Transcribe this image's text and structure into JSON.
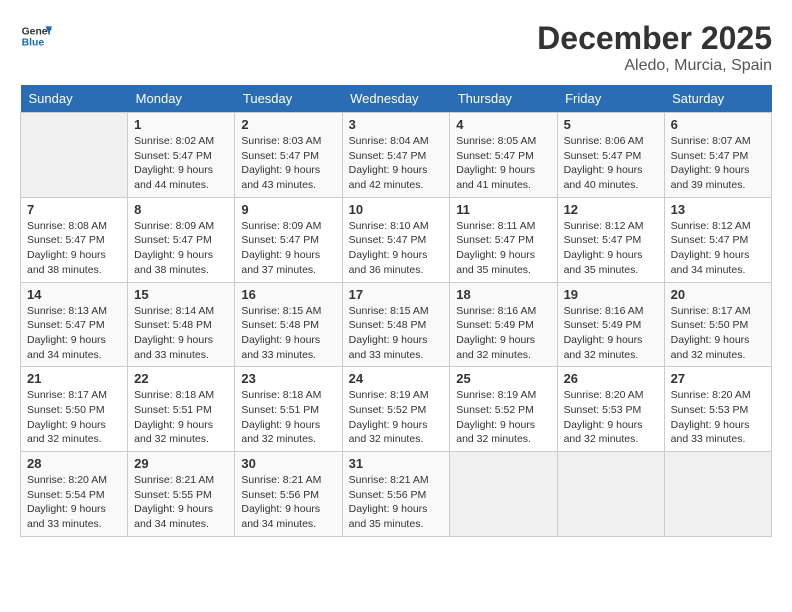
{
  "header": {
    "logo_general": "General",
    "logo_blue": "Blue",
    "month_title": "December 2025",
    "location": "Aledo, Murcia, Spain"
  },
  "days_of_week": [
    "Sunday",
    "Monday",
    "Tuesday",
    "Wednesday",
    "Thursday",
    "Friday",
    "Saturday"
  ],
  "weeks": [
    [
      {
        "day": "",
        "sunrise": "",
        "sunset": "",
        "daylight": ""
      },
      {
        "day": "1",
        "sunrise": "8:02 AM",
        "sunset": "5:47 PM",
        "hours": "9 hours and 44 minutes."
      },
      {
        "day": "2",
        "sunrise": "8:03 AM",
        "sunset": "5:47 PM",
        "hours": "9 hours and 43 minutes."
      },
      {
        "day": "3",
        "sunrise": "8:04 AM",
        "sunset": "5:47 PM",
        "hours": "9 hours and 42 minutes."
      },
      {
        "day": "4",
        "sunrise": "8:05 AM",
        "sunset": "5:47 PM",
        "hours": "9 hours and 41 minutes."
      },
      {
        "day": "5",
        "sunrise": "8:06 AM",
        "sunset": "5:47 PM",
        "hours": "9 hours and 40 minutes."
      },
      {
        "day": "6",
        "sunrise": "8:07 AM",
        "sunset": "5:47 PM",
        "hours": "9 hours and 39 minutes."
      }
    ],
    [
      {
        "day": "7",
        "sunrise": "8:08 AM",
        "sunset": "5:47 PM",
        "hours": "9 hours and 38 minutes."
      },
      {
        "day": "8",
        "sunrise": "8:09 AM",
        "sunset": "5:47 PM",
        "hours": "9 hours and 38 minutes."
      },
      {
        "day": "9",
        "sunrise": "8:09 AM",
        "sunset": "5:47 PM",
        "hours": "9 hours and 37 minutes."
      },
      {
        "day": "10",
        "sunrise": "8:10 AM",
        "sunset": "5:47 PM",
        "hours": "9 hours and 36 minutes."
      },
      {
        "day": "11",
        "sunrise": "8:11 AM",
        "sunset": "5:47 PM",
        "hours": "9 hours and 35 minutes."
      },
      {
        "day": "12",
        "sunrise": "8:12 AM",
        "sunset": "5:47 PM",
        "hours": "9 hours and 35 minutes."
      },
      {
        "day": "13",
        "sunrise": "8:12 AM",
        "sunset": "5:47 PM",
        "hours": "9 hours and 34 minutes."
      }
    ],
    [
      {
        "day": "14",
        "sunrise": "8:13 AM",
        "sunset": "5:47 PM",
        "hours": "9 hours and 34 minutes."
      },
      {
        "day": "15",
        "sunrise": "8:14 AM",
        "sunset": "5:48 PM",
        "hours": "9 hours and 33 minutes."
      },
      {
        "day": "16",
        "sunrise": "8:15 AM",
        "sunset": "5:48 PM",
        "hours": "9 hours and 33 minutes."
      },
      {
        "day": "17",
        "sunrise": "8:15 AM",
        "sunset": "5:48 PM",
        "hours": "9 hours and 33 minutes."
      },
      {
        "day": "18",
        "sunrise": "8:16 AM",
        "sunset": "5:49 PM",
        "hours": "9 hours and 32 minutes."
      },
      {
        "day": "19",
        "sunrise": "8:16 AM",
        "sunset": "5:49 PM",
        "hours": "9 hours and 32 minutes."
      },
      {
        "day": "20",
        "sunrise": "8:17 AM",
        "sunset": "5:50 PM",
        "hours": "9 hours and 32 minutes."
      }
    ],
    [
      {
        "day": "21",
        "sunrise": "8:17 AM",
        "sunset": "5:50 PM",
        "hours": "9 hours and 32 minutes."
      },
      {
        "day": "22",
        "sunrise": "8:18 AM",
        "sunset": "5:51 PM",
        "hours": "9 hours and 32 minutes."
      },
      {
        "day": "23",
        "sunrise": "8:18 AM",
        "sunset": "5:51 PM",
        "hours": "9 hours and 32 minutes."
      },
      {
        "day": "24",
        "sunrise": "8:19 AM",
        "sunset": "5:52 PM",
        "hours": "9 hours and 32 minutes."
      },
      {
        "day": "25",
        "sunrise": "8:19 AM",
        "sunset": "5:52 PM",
        "hours": "9 hours and 32 minutes."
      },
      {
        "day": "26",
        "sunrise": "8:20 AM",
        "sunset": "5:53 PM",
        "hours": "9 hours and 32 minutes."
      },
      {
        "day": "27",
        "sunrise": "8:20 AM",
        "sunset": "5:53 PM",
        "hours": "9 hours and 33 minutes."
      }
    ],
    [
      {
        "day": "28",
        "sunrise": "8:20 AM",
        "sunset": "5:54 PM",
        "hours": "9 hours and 33 minutes."
      },
      {
        "day": "29",
        "sunrise": "8:21 AM",
        "sunset": "5:55 PM",
        "hours": "9 hours and 34 minutes."
      },
      {
        "day": "30",
        "sunrise": "8:21 AM",
        "sunset": "5:56 PM",
        "hours": "9 hours and 34 minutes."
      },
      {
        "day": "31",
        "sunrise": "8:21 AM",
        "sunset": "5:56 PM",
        "hours": "9 hours and 35 minutes."
      },
      {
        "day": "",
        "sunrise": "",
        "sunset": "",
        "hours": ""
      },
      {
        "day": "",
        "sunrise": "",
        "sunset": "",
        "hours": ""
      },
      {
        "day": "",
        "sunrise": "",
        "sunset": "",
        "hours": ""
      }
    ]
  ],
  "labels": {
    "sunrise": "Sunrise:",
    "sunset": "Sunset:",
    "daylight": "Daylight:"
  }
}
